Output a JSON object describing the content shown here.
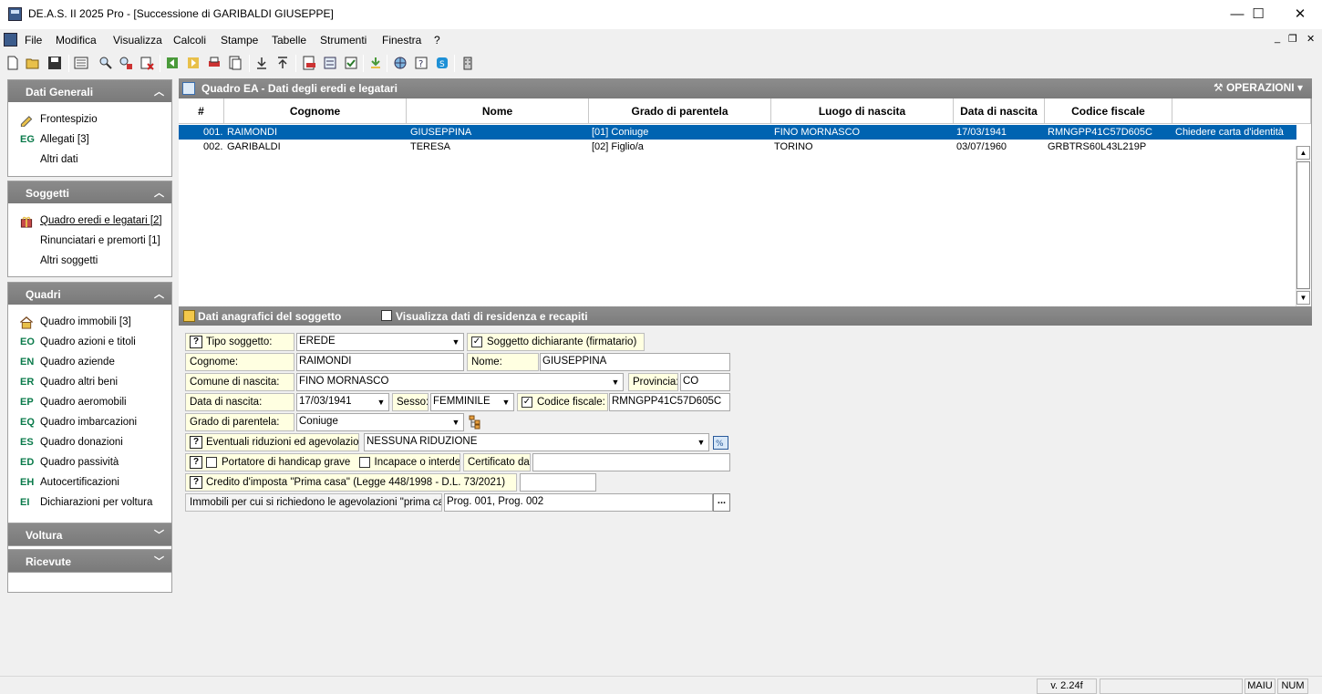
{
  "window": {
    "title": "DE.A.S. II 2025 Pro - [Successione di GARIBALDI GIUSEPPE]",
    "controls": {
      "minimize": "—",
      "maximize": "☐",
      "close": "✕"
    }
  },
  "menu": {
    "items": [
      "File",
      "Modifica",
      "Visualizza",
      "Calcoli",
      "Stampe",
      "Tabelle",
      "Strumenti",
      "Finestra",
      "?"
    ],
    "mdi_controls": {
      "minimize": "_",
      "restore": "❐",
      "close": "✕"
    }
  },
  "sidebar": {
    "dati_generali": {
      "title": "Dati Generali",
      "items": [
        {
          "code": "",
          "icon": "pen-icon",
          "label": "Frontespizio"
        },
        {
          "code": "EG",
          "label": "Allegati [3]"
        },
        {
          "code": "",
          "label": "Altri dati"
        }
      ]
    },
    "soggetti": {
      "title": "Soggetti",
      "items": [
        {
          "code": "",
          "icon": "gift-icon",
          "label": "Quadro eredi e legatari [2]"
        },
        {
          "code": "",
          "label": "Rinunciatari e premorti [1]"
        },
        {
          "code": "",
          "label": "Altri soggetti"
        }
      ]
    },
    "quadri": {
      "title": "Quadri",
      "items": [
        {
          "code": "",
          "icon": "house-icon",
          "label": "Quadro immobili [3]"
        },
        {
          "code": "EO",
          "label": "Quadro azioni e titoli"
        },
        {
          "code": "EN",
          "label": "Quadro aziende"
        },
        {
          "code": "ER",
          "label": "Quadro altri beni"
        },
        {
          "code": "EP",
          "label": "Quadro aeromobili"
        },
        {
          "code": "EQ",
          "label": "Quadro imbarcazioni"
        },
        {
          "code": "ES",
          "label": "Quadro donazioni"
        },
        {
          "code": "ED",
          "label": "Quadro passività"
        },
        {
          "code": "EH",
          "label": "Autocertificazioni"
        },
        {
          "code": "EI",
          "label": "Dichiarazioni per voltura"
        }
      ]
    },
    "voltura": {
      "title": "Voltura"
    },
    "ricevute": {
      "title": "Ricevute"
    }
  },
  "quadro": {
    "title": "Quadro EA - Dati degli eredi e legatari",
    "operations_label": "OPERAZIONI",
    "columns": [
      "#",
      "Cognome",
      "Nome",
      "Grado di parentela",
      "Luogo di nascita",
      "Data di nascita",
      "Codice fiscale"
    ],
    "rows": [
      {
        "num": "001.",
        "cognome": "RAIMONDI",
        "nome": "GIUSEPPINA",
        "grado": "[01] Coniuge",
        "luogo": "FINO MORNASCO",
        "data": "17/03/1941",
        "cf": "RMNGPP41C57D605C",
        "note": "Chiedere carta d'identità"
      },
      {
        "num": "002.",
        "cognome": "GARIBALDI",
        "nome": "TERESA",
        "grado": "[02] Figlio/a",
        "luogo": "TORINO",
        "data": "03/07/1960",
        "cf": "GRBTRS60L43L219P",
        "note": ""
      }
    ]
  },
  "details": {
    "title": "Dati anagrafici del soggetto",
    "show_residence_label": "Visualizza dati di residenza e recapiti",
    "tipo_soggetto": {
      "label": "Tipo soggetto:",
      "value": "EREDE"
    },
    "dichiarante": {
      "label": "Soggetto dichiarante (firmatario)",
      "checked": true
    },
    "cognome": {
      "label": "Cognome:",
      "value": "RAIMONDI"
    },
    "nome": {
      "label": "Nome:",
      "value": "GIUSEPPINA"
    },
    "comune": {
      "label": "Comune di nascita:",
      "value": "FINO MORNASCO"
    },
    "provincia": {
      "label": "Provincia:",
      "value": "CO"
    },
    "data_nascita": {
      "label": "Data di nascita:",
      "value": "17/03/1941"
    },
    "sesso": {
      "label": "Sesso:",
      "value": "FEMMINILE"
    },
    "codice_fiscale": {
      "label": "Codice fiscale:",
      "value": "RMNGPP41C57D605C",
      "checked": true
    },
    "grado": {
      "label": "Grado di parentela:",
      "value": "Coniuge"
    },
    "riduzioni": {
      "label": "Eventuali riduzioni ed agevolazioni:",
      "value": "NESSUNA RIDUZIONE"
    },
    "handicap": {
      "label": "Portatore di handicap grave",
      "checked": false
    },
    "incapace": {
      "label": "Incapace o interdetto",
      "checked": false
    },
    "certificato": {
      "label": "Certificato da:",
      "value": ""
    },
    "credito": {
      "label": "Credito d'imposta \"Prima casa\" (Legge 448/1998 - D.L. 73/2021)",
      "value": ""
    },
    "immobili": {
      "label": "Immobili per cui si richiedono le agevolazioni \"prima casa\":",
      "value": "Prog. 001, Prog. 002",
      "button": "..."
    }
  },
  "status": {
    "version": "v. 2.24f",
    "caps": "MAIU",
    "num": "NUM"
  }
}
